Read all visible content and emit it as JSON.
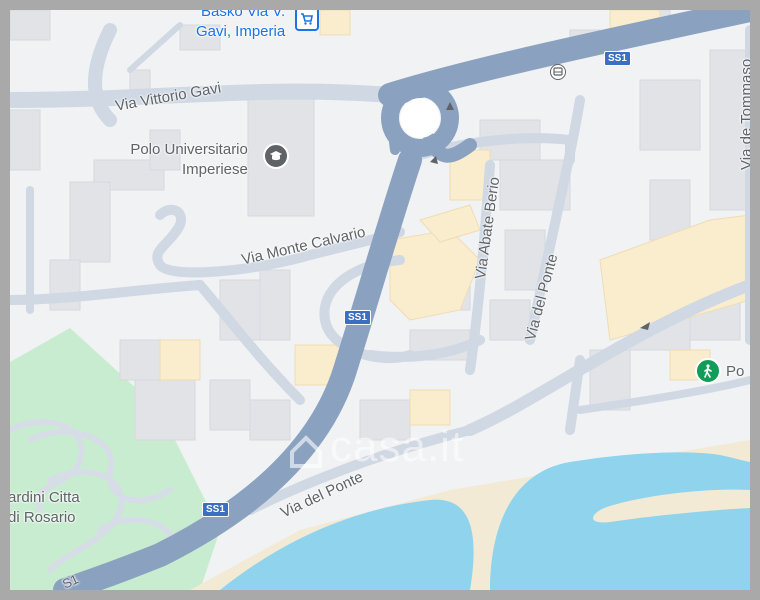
{
  "map": {
    "streets": {
      "via_vittorio_gavi": "Via Vittorio Gavi",
      "via_monte_calvario": "Via Monte Calvario",
      "via_abate_berio": "Via Abate Berio",
      "via_del_ponte_upper": "Via del Ponte",
      "via_del_ponte_lower": "Via del Ponte",
      "via_de_tommaso": "Via de Tommaso"
    },
    "road_shields": {
      "top": "SS1",
      "middle": "SS1",
      "bottom": "SS1",
      "edge": "S1"
    },
    "pois": {
      "basko": {
        "line1": "Basko Via V.",
        "line2": "Gavi, Imperia",
        "icon": "shopping-cart-icon"
      },
      "polo": {
        "line1": "Polo Universitario",
        "line2": "Imperiese",
        "icon": "graduation-cap-icon"
      },
      "giardini": {
        "line1": "ardini Citta",
        "line2": "di Rosario"
      },
      "po": {
        "label": "Po",
        "icon": "hiker-icon"
      }
    },
    "watermark": "casa.it",
    "colors": {
      "land": "#f1f2f4",
      "road_major": "#8aa1c0",
      "road_minor": "#cfd8e3",
      "water": "#8fd4ec",
      "park": "#c8eccf",
      "beach": "#f3ead6",
      "building": "#e1e3e7",
      "building_tan": "#faedcd",
      "poi_blue": "#1a73e8",
      "poi_green": "#0f9d58"
    }
  }
}
